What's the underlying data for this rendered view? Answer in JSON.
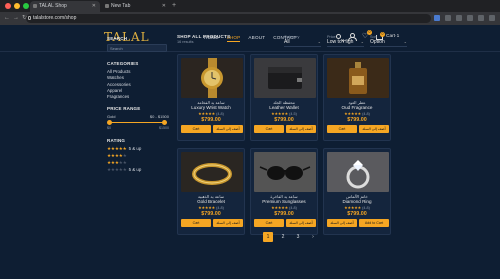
{
  "browser": {
    "tabs": [
      {
        "title": "TALAL Shop"
      },
      {
        "title": "New Tab"
      }
    ],
    "url": "talalstore.com/shop"
  },
  "colors": {
    "accent": "#f5a623",
    "background": "#0e1e33",
    "card": "#14253d"
  },
  "header": {
    "logo": "TALAL",
    "nav": [
      "HOME",
      "SHOP",
      "ABOUT",
      "CONTACT"
    ],
    "active_nav": "SHOP",
    "wishlist_count": "0",
    "cart_count": "0",
    "cart_label": "Cart·1"
  },
  "sidebar": {
    "search_title": "SEARCH",
    "search_placeholder": "Search",
    "categories_title": "CATEGORIES",
    "categories": [
      "All Products",
      "Watches",
      "Accessories",
      "Apparel",
      "Fragrances"
    ],
    "price_title": "PRICE RANGE",
    "price_left_label": "Gold",
    "price_range": "$0 - $1500",
    "price_min": "$0",
    "price_max": "$1500",
    "price_min_fraction": 0,
    "price_max_fraction": 1,
    "rating_title": "RATING",
    "ratings": [
      {
        "stars": 5,
        "label": "5 & up"
      },
      {
        "stars": 4,
        "label": ""
      },
      {
        "stars": 3,
        "label": ""
      },
      {
        "stars": 0,
        "label": "5 & up"
      }
    ]
  },
  "main": {
    "title": "SHOP ALL PRODUCTS",
    "results": "16 results",
    "filters": [
      {
        "label": "Category",
        "value": "All"
      },
      {
        "label": "Price",
        "value": "Low to High"
      },
      {
        "label": "Sort",
        "value": "Option"
      }
    ],
    "products": [
      {
        "arabic": "ساعة يد الفخامة",
        "name": "Luxury Wrist Watch",
        "rating": "(4.8)",
        "stars": 5,
        "price": "$799.00",
        "cart": "Cart",
        "cart_ar": "أضف إلى السلة",
        "image": "gold-watch"
      },
      {
        "arabic": "محفظة الجلد",
        "name": "Leather Wallet",
        "rating": "(4.5)",
        "stars": 5,
        "price": "$799.00",
        "cart": "Cart",
        "cart_ar": "أضف إلى السلة",
        "image": "leather-wallet"
      },
      {
        "arabic": "عطر العود",
        "name": "Oud Fragrance",
        "rating": "(4.8)",
        "stars": 5,
        "price": "$799.00",
        "cart": "Cart",
        "cart_ar": "أضف إلى السلة",
        "image": "oud-perfume"
      },
      {
        "arabic": "ساعة يد الذهبية",
        "name": "Gold Bracelet",
        "rating": "(4.8)",
        "stars": 5,
        "price": "$799.00",
        "cart": "Cart",
        "cart_ar": "أضف إلى السلة",
        "image": "gold-bracelet"
      },
      {
        "arabic": "ساعة يد الفاخرة",
        "name": "Premium Sunglasses",
        "rating": "(4.8)",
        "stars": 5,
        "price": "$799.00",
        "cart": "Cart",
        "cart_ar": "أضف إلى السلة",
        "image": "sunglasses"
      },
      {
        "arabic": "خاتم الألماس",
        "name": "Diamond Ring",
        "rating": "(4.8)",
        "stars": 5,
        "price": "$799.00",
        "cart": "أضف إلى السلة",
        "cart_ar": "Add to Cart",
        "image": "diamond-ring"
      }
    ],
    "pagination": [
      "1",
      "2",
      "3",
      "›"
    ],
    "current_page": "1"
  }
}
